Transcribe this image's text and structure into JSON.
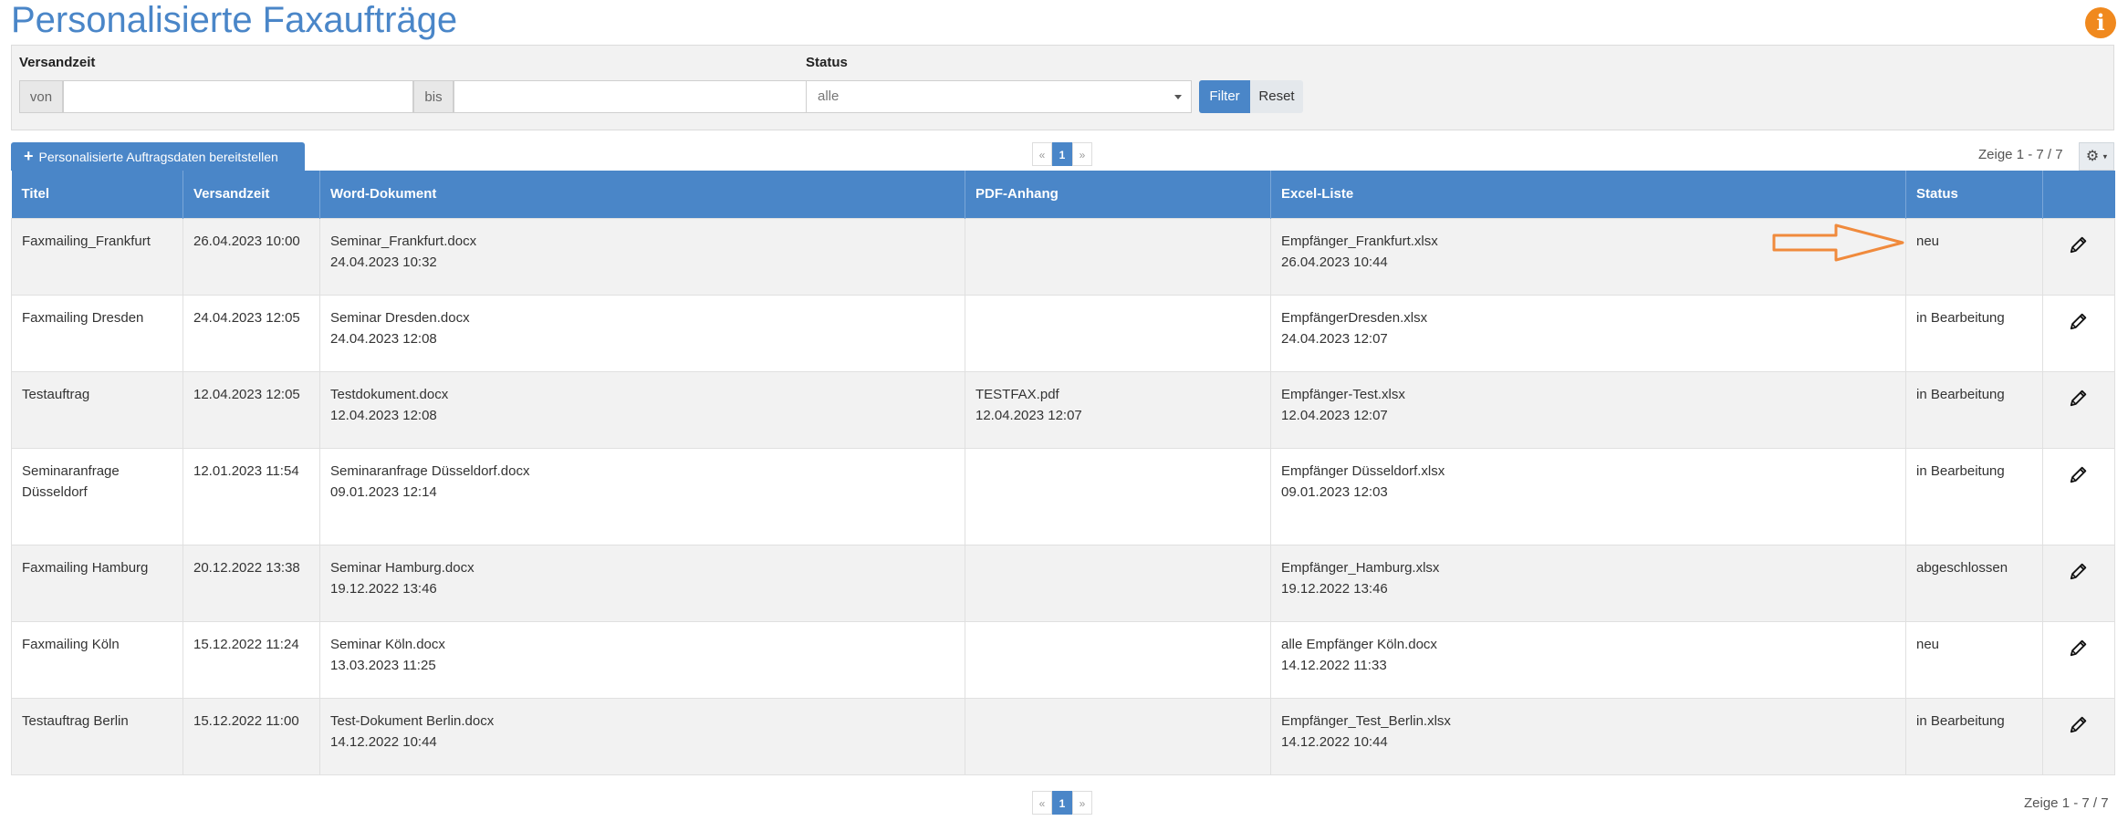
{
  "page": {
    "title": "Personalisierte Faxaufträge"
  },
  "filter": {
    "versandzeit_label": "Versandzeit",
    "von_label": "von",
    "von_value": "",
    "bis_label": "bis",
    "bis_value": "",
    "status_label": "Status",
    "status_selected": "alle",
    "filter_button": "Filter",
    "reset_button": "Reset"
  },
  "toolbar": {
    "add_button": "Personalisierte Auftragsdaten bereitstellen",
    "pager": {
      "prev": "«",
      "page": "1",
      "next": "»"
    },
    "showing": "Zeige 1 - 7 / 7"
  },
  "table": {
    "headers": [
      "Titel",
      "Versandzeit",
      "Word-Dokument",
      "PDF-Anhang",
      "Excel-Liste",
      "Status",
      ""
    ],
    "rows": [
      {
        "titel": "Faxmailing_Frankfurt",
        "versandzeit": "26.04.2023 10:00",
        "word_name": "Seminar_Frankfurt.docx",
        "word_date": "24.04.2023 10:32",
        "pdf_name": "",
        "pdf_date": "",
        "excel_name": "Empfänger_Frankfurt.xlsx",
        "excel_date": "26.04.2023 10:44",
        "status": "neu"
      },
      {
        "titel": "Faxmailing Dresden",
        "versandzeit": "24.04.2023 12:05",
        "word_name": "Seminar Dresden.docx",
        "word_date": "24.04.2023 12:08",
        "pdf_name": "",
        "pdf_date": "",
        "excel_name": "EmpfängerDresden.xlsx",
        "excel_date": "24.04.2023 12:07",
        "status": "in Bearbeitung"
      },
      {
        "titel": "Testauftrag",
        "versandzeit": "12.04.2023 12:05",
        "word_name": "Testdokument.docx",
        "word_date": "12.04.2023 12:08",
        "pdf_name": "TESTFAX.pdf",
        "pdf_date": "12.04.2023 12:07",
        "excel_name": "Empfänger-Test.xlsx",
        "excel_date": "12.04.2023 12:07",
        "status": "in Bearbeitung"
      },
      {
        "titel": "Seminaranfrage Düsseldorf",
        "versandzeit": "12.01.2023 11:54",
        "word_name": "Seminaranfrage Düsseldorf.docx",
        "word_date": "09.01.2023 12:14",
        "pdf_name": "",
        "pdf_date": "",
        "excel_name": "Empfänger Düsseldorf.xlsx",
        "excel_date": "09.01.2023 12:03",
        "status": "in Bearbeitung"
      },
      {
        "titel": "Faxmailing Hamburg",
        "versandzeit": "20.12.2022 13:38",
        "word_name": "Seminar Hamburg.docx",
        "word_date": "19.12.2022 13:46",
        "pdf_name": "",
        "pdf_date": "",
        "excel_name": "Empfänger_Hamburg.xlsx",
        "excel_date": "19.12.2022 13:46",
        "status": "abgeschlossen"
      },
      {
        "titel": "Faxmailing Köln",
        "versandzeit": "15.12.2022 11:24",
        "word_name": "Seminar Köln.docx",
        "word_date": "13.03.2023 11:25",
        "pdf_name": "",
        "pdf_date": "",
        "excel_name": "alle Empfänger Köln.docx",
        "excel_date": "14.12.2022 11:33",
        "status": "neu"
      },
      {
        "titel": "Testauftrag Berlin",
        "versandzeit": "15.12.2022 11:00",
        "word_name": "Test-Dokument Berlin.docx",
        "word_date": "14.12.2022 10:44",
        "pdf_name": "",
        "pdf_date": "",
        "excel_name": "Empfänger_Test_Berlin.xlsx",
        "excel_date": "14.12.2022 10:44",
        "status": "in Bearbeitung"
      }
    ]
  },
  "colors": {
    "primary": "#4a86c8",
    "info": "#f0891e",
    "annotation": "#f08a3c"
  },
  "icons": {
    "info": "info-icon",
    "gear": "gear-icon",
    "edit": "pencil-icon",
    "add": "plus-icon"
  }
}
